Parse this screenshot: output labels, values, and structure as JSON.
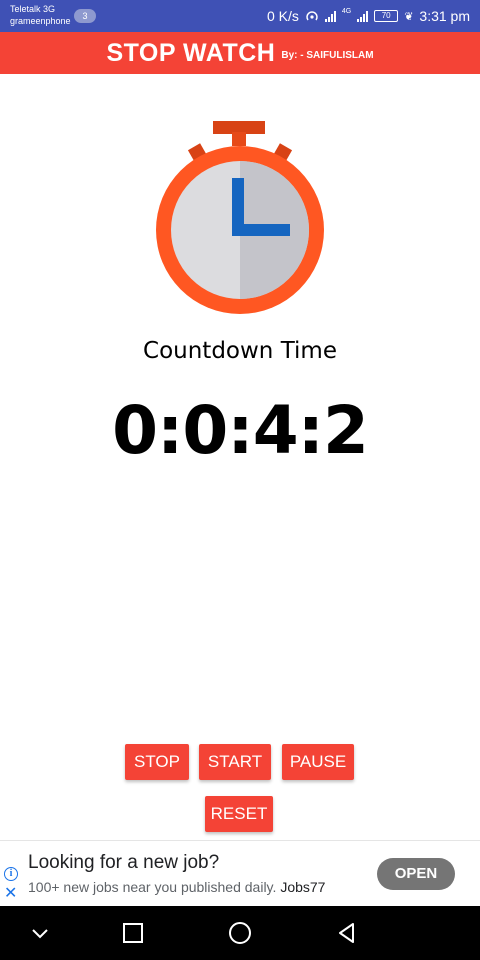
{
  "status_bar": {
    "carrier_1": "Teletalk 3G",
    "carrier_2": "grameenphone",
    "notification_count": "3",
    "net_speed": "0 K/s",
    "net_type": "4G",
    "battery": "70",
    "time": "3:31 pm"
  },
  "app_bar": {
    "title": "STOP WATCH",
    "byline": "By: - SAIFULISLAM",
    "color": "#f44336"
  },
  "main": {
    "label": "Countdown Time",
    "time_value": "0:0:4:2"
  },
  "buttons": {
    "stop": "STOP",
    "start": "START",
    "pause": "PAUSE",
    "reset": "RESET"
  },
  "ad": {
    "headline": "Looking for a new job?",
    "body": "100+ new jobs near you published daily.",
    "brand": "Jobs77",
    "cta": "OPEN"
  },
  "icons": {
    "stopwatch": "stopwatch-icon",
    "nav_down": "chevron-down-icon",
    "nav_recents": "square-icon",
    "nav_home": "circle-icon",
    "nav_back": "triangle-back-icon"
  }
}
